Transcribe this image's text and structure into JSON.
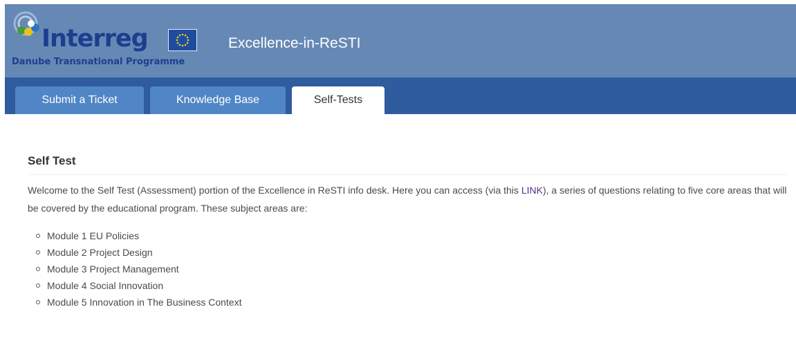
{
  "header": {
    "logo": {
      "wordmark": "Interreg",
      "subtitle": "Danube Transnational Programme"
    },
    "title": "Excellence-in-ReSTI",
    "colors": {
      "header_bg": "#6688b5",
      "tabbar_bg": "#2f5b9f",
      "tab_bg": "#5086c6"
    }
  },
  "tabs": [
    {
      "label": "Submit a Ticket"
    },
    {
      "label": "Knowledge Base"
    },
    {
      "label": "Self-Tests",
      "active": true
    }
  ],
  "main": {
    "title": "Self Test",
    "intro_before_link": "Welcome to the Self Test (Assessment) portion of the Excellence in ReSTI info desk. Here you can access (via this ",
    "link_text": "LINK",
    "intro_after_link": "), a series of questions relating to five core areas that will be covered by the educational program. These subject areas are:",
    "modules": [
      "Module 1 EU Policies",
      "Module 2 Project Design",
      "Module 3 Project Management",
      "Module 4 Social Innovation",
      "Module 5 Innovation in The Business Context"
    ]
  }
}
